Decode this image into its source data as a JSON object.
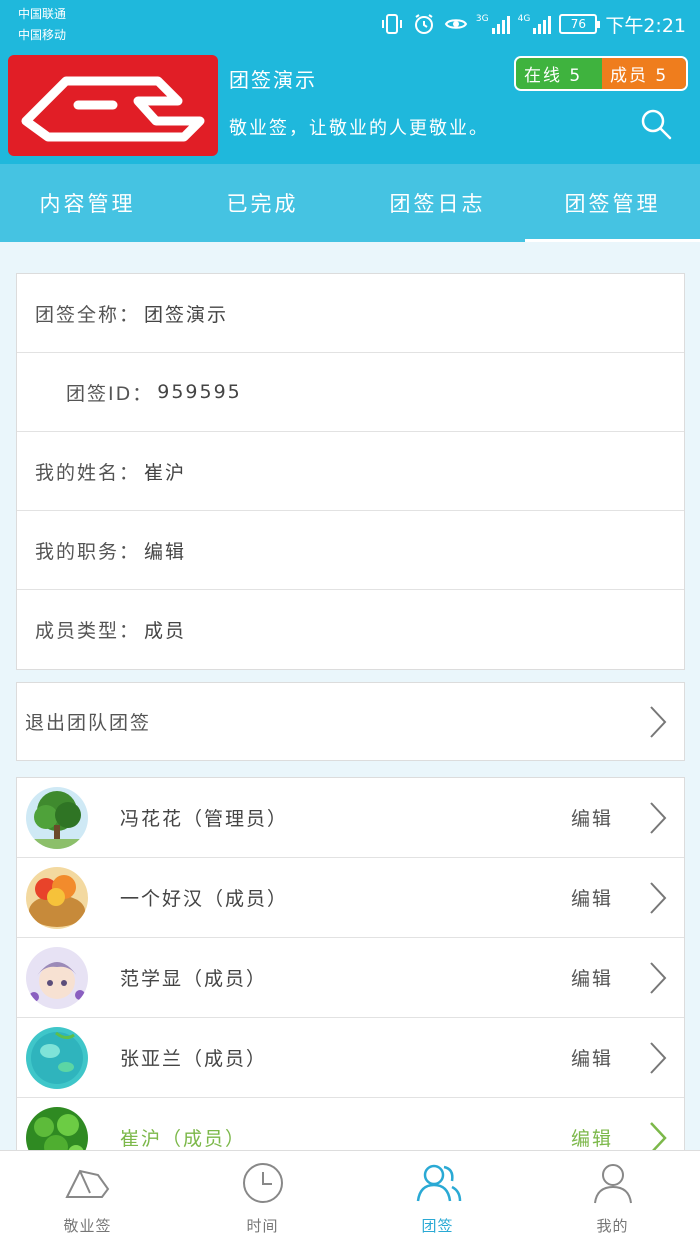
{
  "statusbar": {
    "carrier1": "中国联通",
    "carrier2": "中国移动",
    "net1": "3G",
    "net2": "4G",
    "battery": "76",
    "time": "下午2:21"
  },
  "header": {
    "team_name": "团签演示",
    "slogan": "敬业签，让敬业的人更敬业。",
    "online_label": "在线 5",
    "members_label": "成员 5"
  },
  "tabs": [
    {
      "label": "内容管理",
      "active": false
    },
    {
      "label": "已完成",
      "active": false
    },
    {
      "label": "团签日志",
      "active": false
    },
    {
      "label": "团签管理",
      "active": true
    }
  ],
  "info": [
    {
      "label": "团签全称：",
      "value": "团签演示"
    },
    {
      "label": "团签ID：",
      "value": "959595"
    },
    {
      "label": "我的姓名：",
      "value": "崔沪"
    },
    {
      "label": "我的职务：",
      "value": "编辑"
    },
    {
      "label": "成员类型：",
      "value": "成员"
    }
  ],
  "exit_label": "退出团队团签",
  "members": [
    {
      "name": "冯花花（管理员）",
      "edit": "编辑",
      "avatar": "tree"
    },
    {
      "name": "一个好汉（成员）",
      "edit": "编辑",
      "avatar": "fruit-basket"
    },
    {
      "name": "范学显（成员）",
      "edit": "编辑",
      "avatar": "anime-boy"
    },
    {
      "name": "张亚兰（成员）",
      "edit": "编辑",
      "avatar": "water-drops"
    },
    {
      "name": "崔沪（成员）",
      "edit": "编辑",
      "avatar": "clover"
    }
  ],
  "colors": {
    "primary": "#1fb8dc",
    "tab_bar": "#45c3e2",
    "online": "#3fb33e",
    "members": "#ef7d1d",
    "highlight": "#7cb84a",
    "logo_bg": "#e11e26"
  },
  "bottomnav": [
    {
      "label": "敬业签",
      "icon": "boat-icon",
      "active": false
    },
    {
      "label": "时间",
      "icon": "clock-icon",
      "active": false
    },
    {
      "label": "团签",
      "icon": "team-icon",
      "active": true
    },
    {
      "label": "我的",
      "icon": "user-icon",
      "active": false
    }
  ]
}
